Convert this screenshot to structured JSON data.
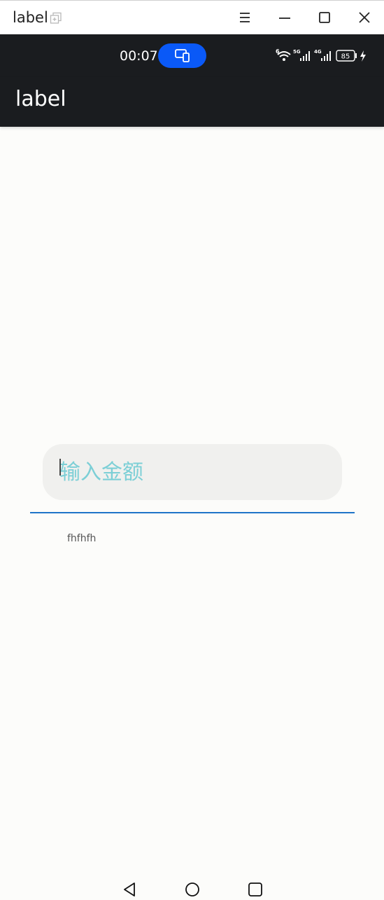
{
  "window": {
    "title": "label",
    "icons": [
      "pin-icon",
      "menu-icon",
      "minimize-icon",
      "maximize-icon",
      "close-icon"
    ]
  },
  "status_bar": {
    "time": "00:07",
    "battery": "85",
    "network_5g": "5G",
    "network_4g": "4G",
    "wifi_tag": "6",
    "icons": [
      "screen-cast-icon",
      "wifi-icon",
      "signal-5g-icon",
      "signal-4g-icon",
      "battery-icon",
      "charging-icon"
    ]
  },
  "app_bar": {
    "title": "label"
  },
  "form": {
    "amount_placeholder": "输入金额",
    "amount_value": "",
    "label_text": "fhfhfh"
  },
  "nav_bar": {
    "icons": [
      "back-icon",
      "home-icon",
      "recents-icon"
    ]
  },
  "colors": {
    "status_bar_bg": "#1a1c1f",
    "cast_pill": "#0a59f7",
    "underline": "#1f74c8",
    "placeholder": "#7ccfd6",
    "page_bg": "#fcfcfa"
  }
}
